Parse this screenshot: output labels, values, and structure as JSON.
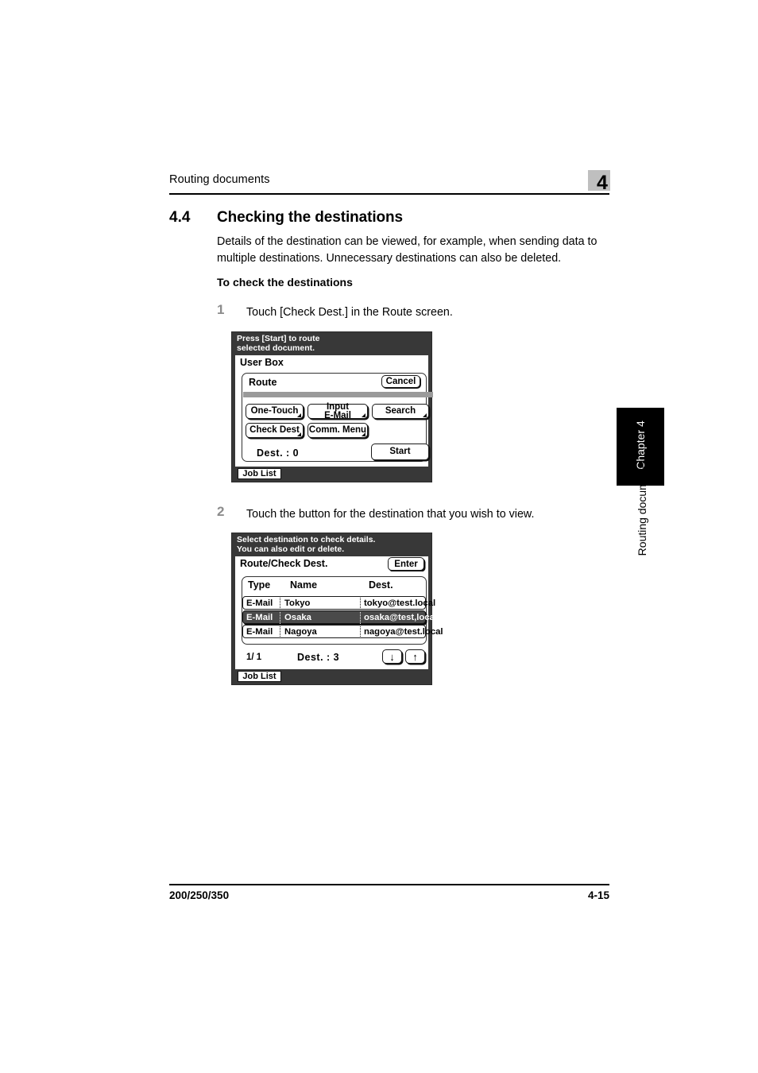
{
  "header": {
    "running_head": "Routing documents",
    "chapter_number": "4"
  },
  "section": {
    "number": "4.4",
    "title": "Checking the destinations",
    "intro": "Details of the destination can be viewed, for example, when sending data to multiple destinations. Unnecessary destinations can also be deleted.",
    "subheading": "To check the destinations"
  },
  "steps": [
    {
      "number": "1",
      "text": "Touch [Check Dest.] in the Route screen."
    },
    {
      "number": "2",
      "text": "Touch the button for the destination that you wish to view."
    }
  ],
  "panel1": {
    "message": "Press [Start] to route\nselected document.",
    "title_bar": "User Box",
    "group_label": "Route",
    "cancel_label": "Cancel",
    "buttons": [
      {
        "label": "One-Touch",
        "has_fold": true
      },
      {
        "label": "Input\nE-Mail",
        "has_fold": true
      },
      {
        "label": "Search",
        "has_fold": true
      },
      {
        "label": "Check Dest",
        "has_fold": true
      },
      {
        "label": "Comm. Menu",
        "has_fold": true
      }
    ],
    "dest_count_label": "Dest.  :  0",
    "start_label": "Start",
    "job_list_label": "Job List"
  },
  "panel2": {
    "message": "Select destination to check details.\nYou can also edit or delete.",
    "title_bar": "Route/Check Dest.",
    "enter_label": "Enter",
    "columns": [
      "Type",
      "Name",
      "Dest."
    ],
    "rows": [
      {
        "type": "E-Mail",
        "name": "Tokyo",
        "dest": "tokyo@test.local",
        "selected": false
      },
      {
        "type": "E-Mail",
        "name": "Osaka",
        "dest": "osaka@test,local",
        "selected": true
      },
      {
        "type": "E-Mail",
        "name": "Nagoya",
        "dest": "nagoya@test.local",
        "selected": false
      }
    ],
    "page_indicator": "1/ 1",
    "dest_count_label": "Dest.  :  3",
    "arrow_down": "↓",
    "arrow_up": "↑",
    "job_list_label": "Job List"
  },
  "side_tab": {
    "chapter_label": "Chapter 4",
    "running_head": "Routing documents"
  },
  "footer": {
    "left": "200/250/350",
    "right": "4-15"
  },
  "colors": {
    "lcd_background": "#383838",
    "lcd_panel": "#ffffff",
    "selected_row": "#4a4a4a",
    "grey_band": "#9a9a9a",
    "chapter_box": "#bfbfbf",
    "step_number": "#8c8c8c"
  }
}
